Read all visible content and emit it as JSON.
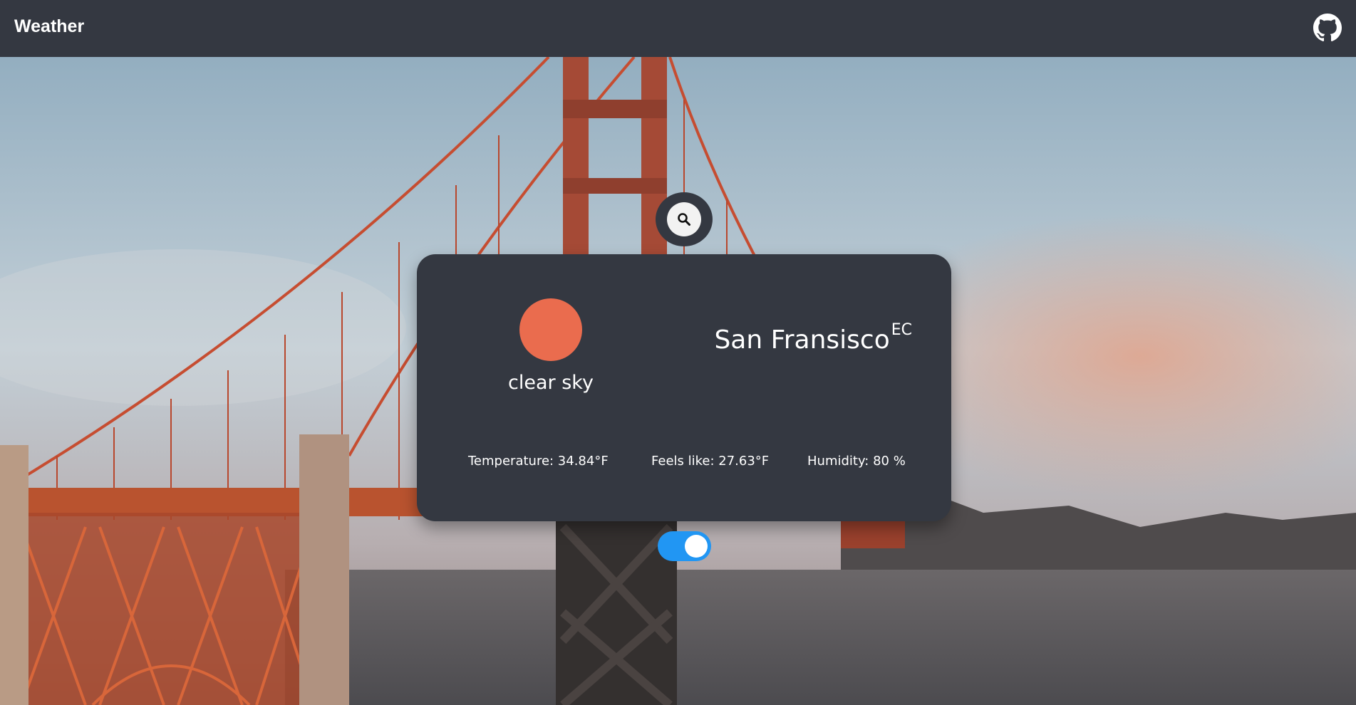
{
  "navbar": {
    "brand": "Weather",
    "github_icon": "github-icon"
  },
  "search": {
    "icon": "search-icon"
  },
  "weather": {
    "icon_color": "#ea6c4e",
    "description": "clear sky",
    "city": "San Fransisco",
    "country": "EC",
    "temperature": "Temperature: 34.84°F",
    "feels_like": "Feels like: 27.63°F",
    "humidity": "Humidity: 80 %"
  },
  "unit_toggle": {
    "state": "on",
    "color": "#2196f3"
  },
  "colors": {
    "navbar": "#343841",
    "card": "#343841"
  }
}
